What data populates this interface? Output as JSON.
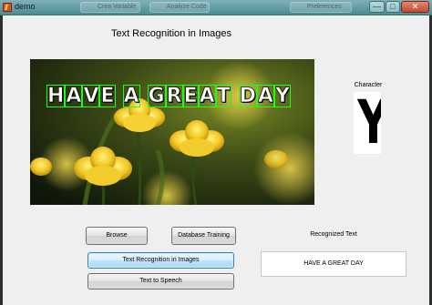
{
  "window": {
    "title": "demo",
    "background_tabs": [
      "Crea Variable",
      "Analyze Code",
      "Preferences"
    ],
    "minimize_glyph": "—",
    "maximize_glyph": "□",
    "close_glyph": "✕"
  },
  "app": {
    "title": "Text Recognition in Images"
  },
  "image": {
    "detected_text": "HAVE A GREAT DAY",
    "characters": [
      "H",
      "A",
      "V",
      "E",
      " ",
      "A",
      " ",
      "G",
      "R",
      "E",
      "A",
      "T",
      " ",
      "D",
      "A",
      "Y"
    ],
    "box_color": "#18ff18"
  },
  "character_panel": {
    "label": "Character",
    "glyph": "Y"
  },
  "buttons": {
    "browse": "Browse",
    "database_training": "Database Training",
    "text_recognition": "Text Recognition in Images",
    "text_to_speech": "Text to Speech"
  },
  "result": {
    "label": "Recognized Text",
    "value": "HAVE A GREAT DAY"
  },
  "colors": {
    "titlebar": "#6aa6ad",
    "client_bg": "#efefef",
    "active_button": "#bee6fd"
  },
  "icons": {
    "app": "matlab-figure-icon",
    "minimize": "minimize-icon",
    "maximize": "maximize-icon",
    "close": "close-icon"
  }
}
